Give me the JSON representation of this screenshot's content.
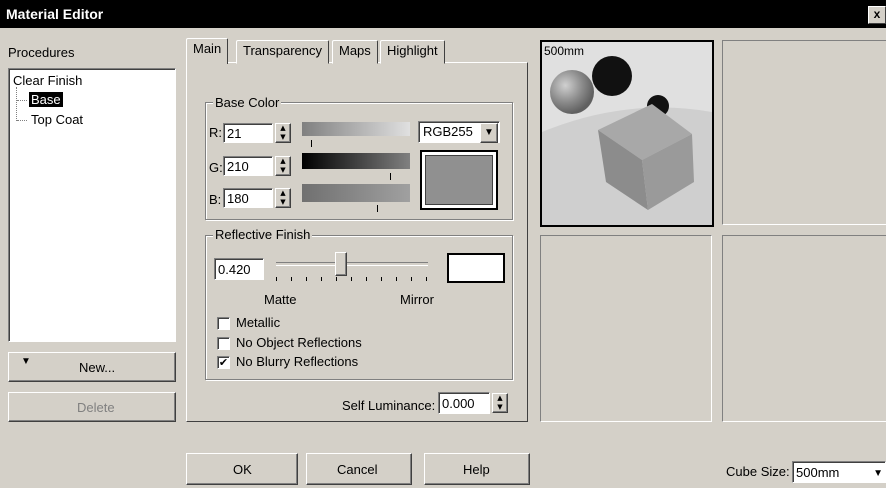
{
  "window": {
    "title": "Material Editor",
    "close_glyph": "x"
  },
  "procedures": {
    "label": "Procedures",
    "tree": [
      {
        "label": "Clear Finish"
      },
      {
        "label": "Base",
        "selected": true
      },
      {
        "label": "Top Coat"
      }
    ],
    "new_button": "New...",
    "delete_button": "Delete"
  },
  "tabs": [
    {
      "label": "Main",
      "active": true
    },
    {
      "label": "Transparency"
    },
    {
      "label": "Maps"
    },
    {
      "label": "Highlight"
    }
  ],
  "base_color": {
    "legend": "Base Color",
    "channels": [
      {
        "label": "R:",
        "value": "21",
        "level": 0.08
      },
      {
        "label": "G:",
        "value": "210",
        "level": 0.82
      },
      {
        "label": "B:",
        "value": "180",
        "level": 0.71
      }
    ],
    "mode": "RGB255",
    "swatch_color": "#909090"
  },
  "reflective": {
    "legend": "Reflective Finish",
    "value": "0.420",
    "slider_level": 0.42,
    "left_label": "Matte",
    "right_label": "Mirror",
    "swatch_color": "#ffffff"
  },
  "options": [
    {
      "label": "Metallic",
      "checked": false
    },
    {
      "label": "No Object Reflections",
      "checked": false
    },
    {
      "label": "No Blurry Reflections",
      "checked": true
    }
  ],
  "self_luminance": {
    "label": "Self Luminance:",
    "value": "0.000"
  },
  "preview": {
    "label": "500mm"
  },
  "buttons": {
    "ok": "OK",
    "cancel": "Cancel",
    "help": "Help"
  },
  "cube_size": {
    "label": "Cube Size:",
    "value": "500mm"
  }
}
